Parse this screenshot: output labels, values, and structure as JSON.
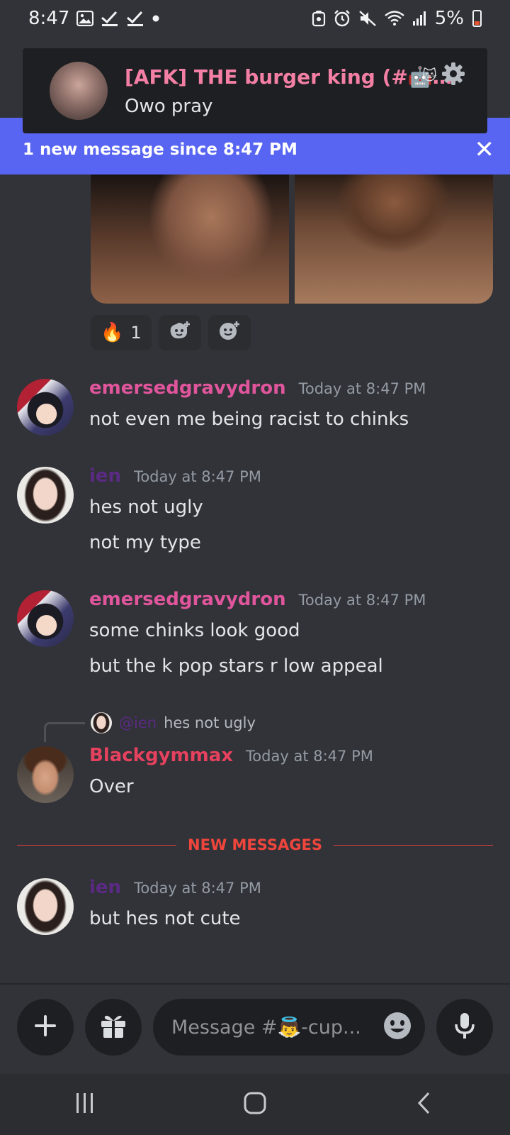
{
  "status_bar": {
    "time": "8:47",
    "battery": "5%"
  },
  "notification": {
    "title": "[AFK] THE burger king (#🤖…",
    "body": "Owo pray",
    "emoji_badge": "🐱"
  },
  "banner": {
    "text": "1 new message since 8:47 PM",
    "close": "✕"
  },
  "reactions": [
    {
      "emoji": "🔥",
      "count": "1"
    }
  ],
  "messages": [
    {
      "username": "emersedgravydron",
      "timestamp": "Today at 8:47 PM",
      "lines": [
        "not even me being racist to chinks"
      ]
    },
    {
      "username": "ien",
      "timestamp": "Today at 8:47 PM",
      "lines": [
        "hes not ugly",
        "not my type"
      ]
    },
    {
      "username": "emersedgravydron",
      "timestamp": "Today at 8:47 PM",
      "lines": [
        "some chinks look good",
        "but the k pop stars r low appeal"
      ]
    },
    {
      "username": "Blackgymmax",
      "timestamp": "Today at 8:47 PM",
      "reply": {
        "mention": "@ien",
        "text": "hes not ugly"
      },
      "lines": [
        "Over"
      ]
    },
    {
      "username": "ien",
      "timestamp": "Today at 8:47 PM",
      "lines": [
        "but hes not cute"
      ]
    }
  ],
  "divider": {
    "label": "NEW MESSAGES"
  },
  "composer": {
    "placeholder": "Message #👼-cup..."
  },
  "colors": {
    "background": "#313338",
    "blurple": "#5865f2",
    "new_messages_red": "#f0453d",
    "pink_role": "#e0559c",
    "purple_role": "#5b2a84",
    "red_role": "#e6415e"
  }
}
